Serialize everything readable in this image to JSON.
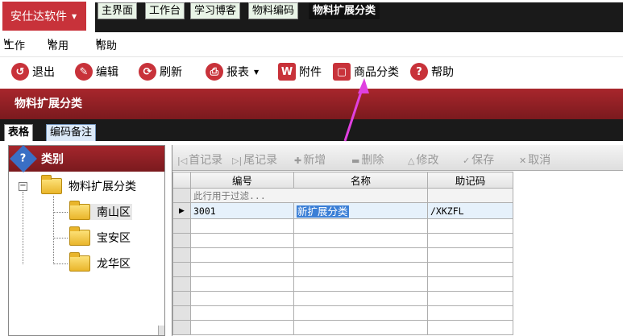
{
  "app": {
    "name": "安仕达软件"
  },
  "tabs": [
    {
      "label": "主界面"
    },
    {
      "label": "工作台"
    },
    {
      "label": "学习博客"
    },
    {
      "label": "物料编码"
    },
    {
      "label": "物料扩展分类",
      "active": true
    }
  ],
  "menu": [
    {
      "key": "W",
      "label": "工作"
    },
    {
      "key": "U",
      "label": "常用"
    },
    {
      "key": "H",
      "label": "帮助"
    }
  ],
  "toolbar": {
    "exit": "退出",
    "edit": "编辑",
    "refresh": "刷新",
    "report": "报表",
    "attachment": "附件",
    "product_category": "商品分类",
    "help": "帮助"
  },
  "page_title": "物料扩展分类",
  "subtabs": {
    "grid": "表格",
    "code_note": "编码备注"
  },
  "category_panel": {
    "title": "类别",
    "root": "物料扩展分类",
    "children": [
      "南山区",
      "宝安区",
      "龙华区"
    ]
  },
  "grid_toolbar": {
    "first": "首记录",
    "last": "尾记录",
    "add": "新增",
    "delete": "删除",
    "modify": "修改",
    "save": "保存",
    "cancel": "取消"
  },
  "grid": {
    "columns": [
      "编号",
      "名称",
      "助记码"
    ],
    "filter_hint": "此行用于过滤...",
    "rows": [
      {
        "code": "3001",
        "name": "新扩展分类",
        "mnemonic": "/XKZFL"
      }
    ]
  },
  "colors": {
    "accent": "#c8323a",
    "band": "#8f2025",
    "annotation_arrow": "#e040e0"
  }
}
